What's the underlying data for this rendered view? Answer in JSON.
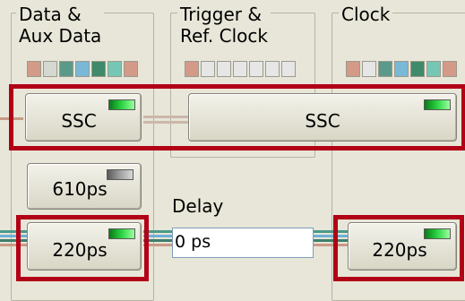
{
  "groups": {
    "data": {
      "title_line1": "Data &",
      "title_line2": "Aux Data"
    },
    "trigger": {
      "title_line1": "Trigger &",
      "title_line2": "Ref. Clock"
    },
    "clock": {
      "title": "Clock"
    }
  },
  "swatch_colors": {
    "data": [
      "#d49a88",
      "#d4d8d0",
      "#5b9a8a",
      "#79b8d6",
      "#3e8a6a",
      "#76c6b4",
      "#d49a88"
    ],
    "trigger": [
      "#d49a88",
      "#e6e6e6",
      "#e6e6e6",
      "#e6e6e6",
      "#e6e6e6",
      "#e6e6e6",
      "#e6e6e6"
    ],
    "clock": [
      "#d49a88",
      "#e6e6e6",
      "#5b9a8a",
      "#79b8d6",
      "#3e8a6a",
      "#76c6b4",
      "#d49a88"
    ]
  },
  "buttons": {
    "data_ssc": {
      "label": "SSC",
      "led": "on"
    },
    "trigger_ssc": {
      "label": "SSC",
      "led": "on"
    },
    "data_610": {
      "label": "610ps",
      "led": "off"
    },
    "data_220": {
      "label": "220ps",
      "led": "on"
    },
    "clock_220": {
      "label": "220ps",
      "led": "on"
    }
  },
  "delay": {
    "label": "Delay",
    "value": "0 ps"
  },
  "colors": {
    "highlight": "#b20016",
    "led_on": "#2bd544",
    "led_off": "#a0a0a0",
    "bus": [
      "#4a9a8a",
      "#6fb0d8",
      "#3f7f6c",
      "#c99a86"
    ]
  }
}
